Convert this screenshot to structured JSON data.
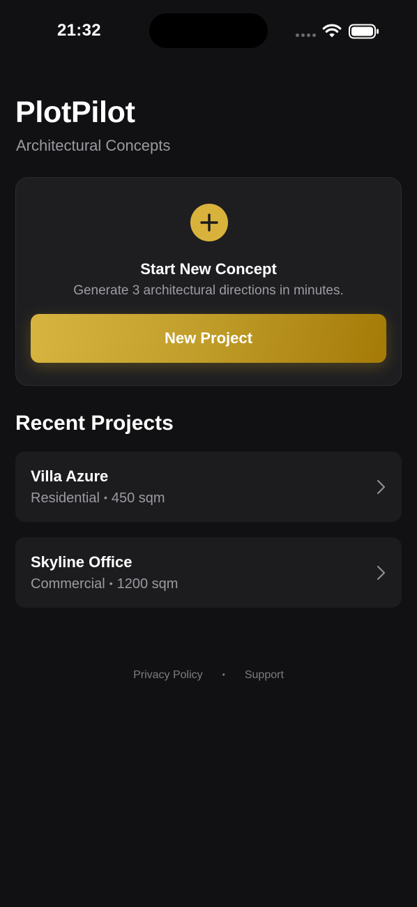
{
  "status_bar": {
    "time": "21:32"
  },
  "header": {
    "title": "PlotPilot",
    "subtitle": "Architectural Concepts"
  },
  "concept_card": {
    "icon": "plus-icon",
    "heading": "Start New Concept",
    "description": "Generate 3 architectural directions in minutes.",
    "button_label": "New Project"
  },
  "recent": {
    "title": "Recent Projects",
    "projects": [
      {
        "name": "Villa Azure",
        "type": "Residential",
        "area": "450 sqm"
      },
      {
        "name": "Skyline Office",
        "type": "Commercial",
        "area": "1200 sqm"
      }
    ],
    "separator": "•"
  },
  "footer": {
    "privacy_label": "Privacy Policy",
    "separator": "•",
    "support_label": "Support"
  },
  "colors": {
    "background": "#111113",
    "card": "#1e1e21",
    "accent": "#d9b23c",
    "accent_dark": "#a57a07",
    "muted_text": "#9a9aa0"
  }
}
